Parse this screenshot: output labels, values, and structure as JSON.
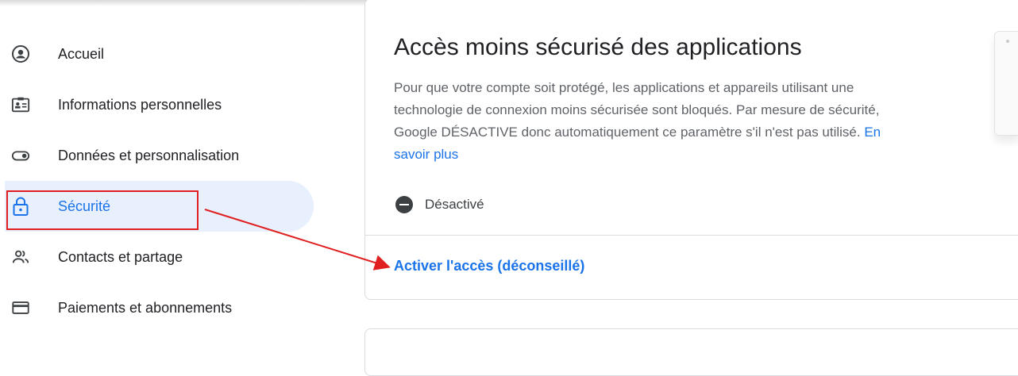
{
  "sidebar": {
    "items": [
      {
        "label": "Accueil",
        "icon": "account-circle-icon"
      },
      {
        "label": "Informations personnelles",
        "icon": "id-card-icon"
      },
      {
        "label": "Données et personnalisation",
        "icon": "toggle-icon"
      },
      {
        "label": "Sécurité",
        "icon": "lock-icon"
      },
      {
        "label": "Contacts et partage",
        "icon": "people-icon"
      },
      {
        "label": "Paiements et abonnements",
        "icon": "credit-card-icon"
      }
    ],
    "active_index": 3
  },
  "card": {
    "title": "Accès moins sécurisé des applications",
    "description": "Pour que votre compte soit protégé, les applications et appareils utilisant une technologie de connexion moins sécurisée sont bloqués. Par mesure de sécurité, Google DÉSACTIVE donc automatiquement ce paramètre s'il n'est pas utilisé.",
    "learn_more": "En savoir plus",
    "status": "Désactivé",
    "action": "Activer l'accès (déconseillé)"
  },
  "colors": {
    "accent": "#1a73e8",
    "active_bg": "#e8f0fe",
    "annotation": "#e02020"
  }
}
